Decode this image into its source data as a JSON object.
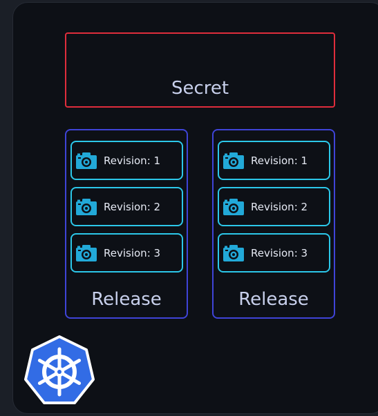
{
  "diagram": {
    "secret": {
      "label": "Secret"
    },
    "releases": [
      {
        "label": "Release",
        "revisions": [
          {
            "label": "Revision: 1"
          },
          {
            "label": "Revision: 2"
          },
          {
            "label": "Revision: 3"
          }
        ]
      },
      {
        "label": "Release",
        "revisions": [
          {
            "label": "Revision: 1"
          },
          {
            "label": "Revision: 2"
          },
          {
            "label": "Revision: 3"
          }
        ]
      }
    ],
    "colors": {
      "secret_border": "#e02d3c",
      "release_border": "#3f44d8",
      "revision_border": "#2cc8ea",
      "camera_icon": "#22a9d8",
      "kubernetes_logo": "#326ce5"
    },
    "icons": {
      "revision": "camera-icon",
      "logo": "kubernetes-helm-icon"
    }
  }
}
